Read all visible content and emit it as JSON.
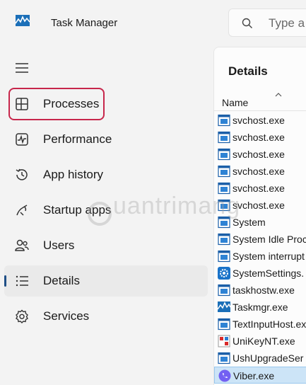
{
  "app": {
    "title": "Task Manager"
  },
  "search": {
    "placeholder": "Type a"
  },
  "nav": {
    "items": [
      {
        "label": "Processes",
        "icon": "processes-icon"
      },
      {
        "label": "Performance",
        "icon": "performance-icon"
      },
      {
        "label": "App history",
        "icon": "history-icon"
      },
      {
        "label": "Startup apps",
        "icon": "startup-icon"
      },
      {
        "label": "Users",
        "icon": "users-icon"
      },
      {
        "label": "Details",
        "icon": "details-icon",
        "selected": true
      },
      {
        "label": "Services",
        "icon": "services-icon"
      }
    ]
  },
  "details": {
    "title": "Details",
    "column_name": "Name",
    "rows": [
      {
        "name": "svchost.exe",
        "icon": "generic-exe-icon"
      },
      {
        "name": "svchost.exe",
        "icon": "generic-exe-icon"
      },
      {
        "name": "svchost.exe",
        "icon": "generic-exe-icon"
      },
      {
        "name": "svchost.exe",
        "icon": "generic-exe-icon"
      },
      {
        "name": "svchost.exe",
        "icon": "generic-exe-icon"
      },
      {
        "name": "svchost.exe",
        "icon": "generic-exe-icon"
      },
      {
        "name": "System",
        "icon": "generic-exe-icon"
      },
      {
        "name": "System Idle Proc",
        "icon": "generic-exe-icon"
      },
      {
        "name": "System interrupt",
        "icon": "generic-exe-icon"
      },
      {
        "name": "SystemSettings.",
        "icon": "settings-gear-icon"
      },
      {
        "name": "taskhostw.exe",
        "icon": "generic-exe-icon"
      },
      {
        "name": "Taskmgr.exe",
        "icon": "taskmgr-icon"
      },
      {
        "name": "TextInputHost.ex",
        "icon": "generic-exe-icon"
      },
      {
        "name": "UniKeyNT.exe",
        "icon": "unikey-icon"
      },
      {
        "name": "UshUpgradeSer",
        "icon": "generic-exe-icon"
      },
      {
        "name": "Viber.exe",
        "icon": "viber-icon",
        "selected": true
      }
    ]
  },
  "watermark": {
    "text": "uantrimang"
  },
  "colors": {
    "accent": "#1f4f86",
    "highlight_box": "#c7264b",
    "selection": "#cce4f7"
  }
}
